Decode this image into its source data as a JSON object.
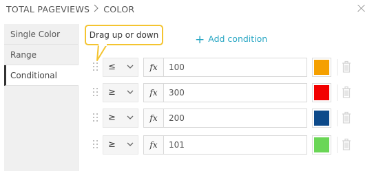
{
  "header": {
    "breadcrumb_parent": "TOTAL PAGEVIEWS",
    "breadcrumb_current": "COLOR"
  },
  "sidebar": {
    "items": [
      {
        "label": "Single Color",
        "active": false
      },
      {
        "label": "Range",
        "active": false
      },
      {
        "label": "Conditional",
        "active": true
      }
    ]
  },
  "tooltip": {
    "text": "Drag up or down"
  },
  "add_condition": {
    "label": "Add condition"
  },
  "conditions": [
    {
      "operator": "≤",
      "fx": "fx",
      "value": "100",
      "color": "#f5a000"
    },
    {
      "operator": "≥",
      "fx": "fx",
      "value": "300",
      "color": "#f20000"
    },
    {
      "operator": "≥",
      "fx": "fx",
      "value": "200",
      "color": "#0d4a8a"
    },
    {
      "operator": "≥",
      "fx": "fx",
      "value": "101",
      "color": "#6ad656"
    }
  ],
  "colors": {
    "accent": "#2aa7c4",
    "tooltip_border": "#f4c430"
  },
  "icons": {
    "close": "close-icon",
    "drag": "drag-handle-icon",
    "chevron": "chevron-down-icon",
    "trash": "trash-icon",
    "plus": "plus-icon"
  }
}
